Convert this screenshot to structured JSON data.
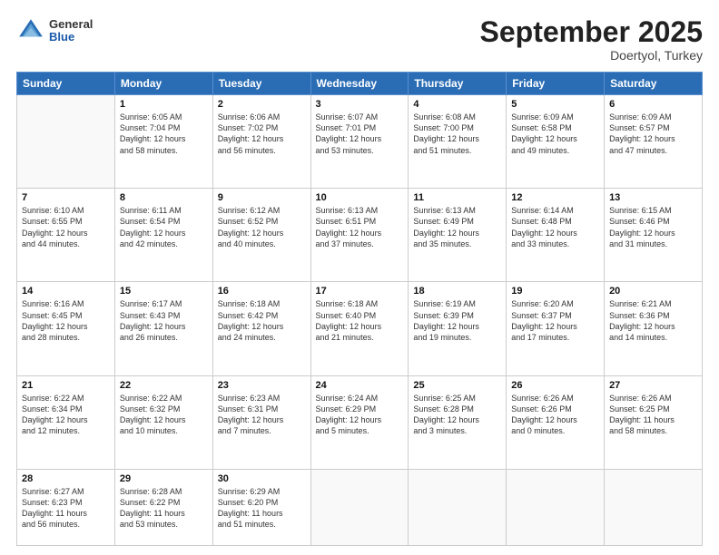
{
  "header": {
    "logo": {
      "general": "General",
      "blue": "Blue"
    },
    "title": "September 2025",
    "location": "Doertyol, Turkey"
  },
  "weekdays": [
    "Sunday",
    "Monday",
    "Tuesday",
    "Wednesday",
    "Thursday",
    "Friday",
    "Saturday"
  ],
  "weeks": [
    [
      {
        "day": "",
        "info": ""
      },
      {
        "day": "1",
        "info": "Sunrise: 6:05 AM\nSunset: 7:04 PM\nDaylight: 12 hours\nand 58 minutes."
      },
      {
        "day": "2",
        "info": "Sunrise: 6:06 AM\nSunset: 7:02 PM\nDaylight: 12 hours\nand 56 minutes."
      },
      {
        "day": "3",
        "info": "Sunrise: 6:07 AM\nSunset: 7:01 PM\nDaylight: 12 hours\nand 53 minutes."
      },
      {
        "day": "4",
        "info": "Sunrise: 6:08 AM\nSunset: 7:00 PM\nDaylight: 12 hours\nand 51 minutes."
      },
      {
        "day": "5",
        "info": "Sunrise: 6:09 AM\nSunset: 6:58 PM\nDaylight: 12 hours\nand 49 minutes."
      },
      {
        "day": "6",
        "info": "Sunrise: 6:09 AM\nSunset: 6:57 PM\nDaylight: 12 hours\nand 47 minutes."
      }
    ],
    [
      {
        "day": "7",
        "info": "Sunrise: 6:10 AM\nSunset: 6:55 PM\nDaylight: 12 hours\nand 44 minutes."
      },
      {
        "day": "8",
        "info": "Sunrise: 6:11 AM\nSunset: 6:54 PM\nDaylight: 12 hours\nand 42 minutes."
      },
      {
        "day": "9",
        "info": "Sunrise: 6:12 AM\nSunset: 6:52 PM\nDaylight: 12 hours\nand 40 minutes."
      },
      {
        "day": "10",
        "info": "Sunrise: 6:13 AM\nSunset: 6:51 PM\nDaylight: 12 hours\nand 37 minutes."
      },
      {
        "day": "11",
        "info": "Sunrise: 6:13 AM\nSunset: 6:49 PM\nDaylight: 12 hours\nand 35 minutes."
      },
      {
        "day": "12",
        "info": "Sunrise: 6:14 AM\nSunset: 6:48 PM\nDaylight: 12 hours\nand 33 minutes."
      },
      {
        "day": "13",
        "info": "Sunrise: 6:15 AM\nSunset: 6:46 PM\nDaylight: 12 hours\nand 31 minutes."
      }
    ],
    [
      {
        "day": "14",
        "info": "Sunrise: 6:16 AM\nSunset: 6:45 PM\nDaylight: 12 hours\nand 28 minutes."
      },
      {
        "day": "15",
        "info": "Sunrise: 6:17 AM\nSunset: 6:43 PM\nDaylight: 12 hours\nand 26 minutes."
      },
      {
        "day": "16",
        "info": "Sunrise: 6:18 AM\nSunset: 6:42 PM\nDaylight: 12 hours\nand 24 minutes."
      },
      {
        "day": "17",
        "info": "Sunrise: 6:18 AM\nSunset: 6:40 PM\nDaylight: 12 hours\nand 21 minutes."
      },
      {
        "day": "18",
        "info": "Sunrise: 6:19 AM\nSunset: 6:39 PM\nDaylight: 12 hours\nand 19 minutes."
      },
      {
        "day": "19",
        "info": "Sunrise: 6:20 AM\nSunset: 6:37 PM\nDaylight: 12 hours\nand 17 minutes."
      },
      {
        "day": "20",
        "info": "Sunrise: 6:21 AM\nSunset: 6:36 PM\nDaylight: 12 hours\nand 14 minutes."
      }
    ],
    [
      {
        "day": "21",
        "info": "Sunrise: 6:22 AM\nSunset: 6:34 PM\nDaylight: 12 hours\nand 12 minutes."
      },
      {
        "day": "22",
        "info": "Sunrise: 6:22 AM\nSunset: 6:32 PM\nDaylight: 12 hours\nand 10 minutes."
      },
      {
        "day": "23",
        "info": "Sunrise: 6:23 AM\nSunset: 6:31 PM\nDaylight: 12 hours\nand 7 minutes."
      },
      {
        "day": "24",
        "info": "Sunrise: 6:24 AM\nSunset: 6:29 PM\nDaylight: 12 hours\nand 5 minutes."
      },
      {
        "day": "25",
        "info": "Sunrise: 6:25 AM\nSunset: 6:28 PM\nDaylight: 12 hours\nand 3 minutes."
      },
      {
        "day": "26",
        "info": "Sunrise: 6:26 AM\nSunset: 6:26 PM\nDaylight: 12 hours\nand 0 minutes."
      },
      {
        "day": "27",
        "info": "Sunrise: 6:26 AM\nSunset: 6:25 PM\nDaylight: 11 hours\nand 58 minutes."
      }
    ],
    [
      {
        "day": "28",
        "info": "Sunrise: 6:27 AM\nSunset: 6:23 PM\nDaylight: 11 hours\nand 56 minutes."
      },
      {
        "day": "29",
        "info": "Sunrise: 6:28 AM\nSunset: 6:22 PM\nDaylight: 11 hours\nand 53 minutes."
      },
      {
        "day": "30",
        "info": "Sunrise: 6:29 AM\nSunset: 6:20 PM\nDaylight: 11 hours\nand 51 minutes."
      },
      {
        "day": "",
        "info": ""
      },
      {
        "day": "",
        "info": ""
      },
      {
        "day": "",
        "info": ""
      },
      {
        "day": "",
        "info": ""
      }
    ]
  ]
}
